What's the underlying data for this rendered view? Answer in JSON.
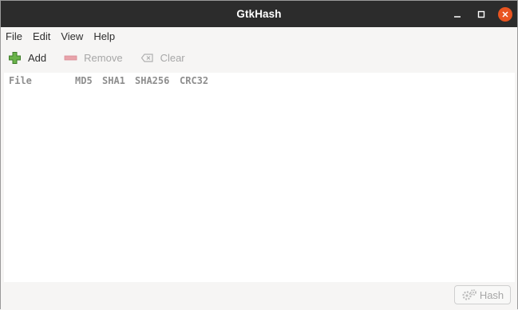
{
  "window": {
    "title": "GtkHash",
    "controls": [
      "minimize-icon",
      "maximize-icon",
      "close-icon"
    ],
    "accent_close": "#e95420"
  },
  "menubar": {
    "items": [
      {
        "label": "File"
      },
      {
        "label": "Edit"
      },
      {
        "label": "View"
      },
      {
        "label": "Help"
      }
    ]
  },
  "toolbar": {
    "add": {
      "label": "Add",
      "icon": "plus-icon",
      "enabled": true
    },
    "remove": {
      "label": "Remove",
      "icon": "minus-icon",
      "enabled": false
    },
    "clear": {
      "label": "Clear",
      "icon": "clear-icon",
      "enabled": false
    }
  },
  "table": {
    "columns": [
      "File",
      "MD5",
      "SHA1",
      "SHA256",
      "CRC32"
    ],
    "rows": []
  },
  "footer": {
    "hash_button": {
      "label": "Hash",
      "icon": "gears-icon",
      "enabled": false
    }
  }
}
